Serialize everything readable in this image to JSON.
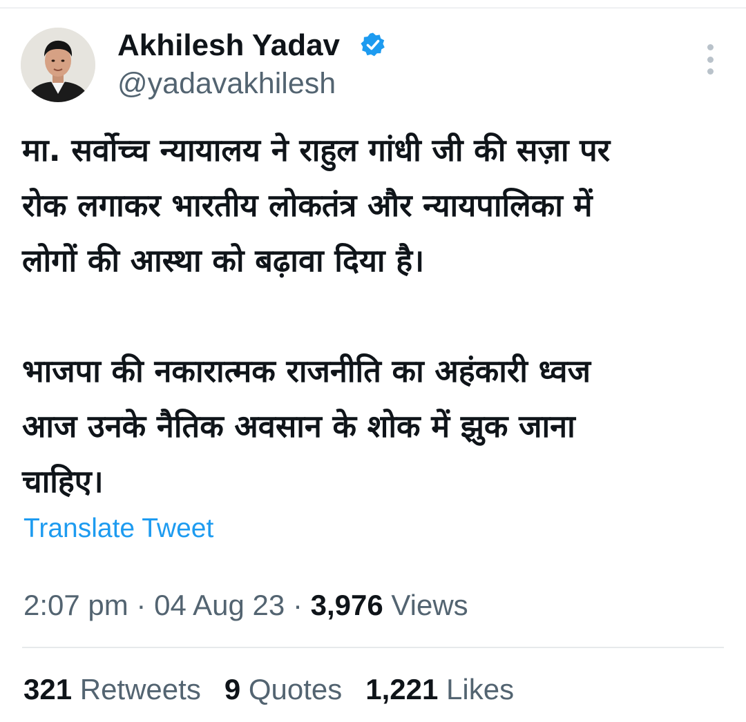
{
  "author": {
    "display_name": "Akhilesh Yadav",
    "handle": "@yadavakhilesh",
    "verified": true
  },
  "icons": {
    "avatar": "profile-photo",
    "verified": "verified-badge-icon",
    "more": "more-options-icon"
  },
  "tweet": {
    "text": "मा. सर्वोच्च न्यायालय ने राहुल गांधी जी की सज़ा पर\nरोक लगाकर भारतीय लोकतंत्र और न्यायपालिका में\nलोगों की आस्था को बढ़ावा दिया है।\n\nभाजपा की नकारात्मक राजनीति का अहंकारी ध्वज\nआज उनके नैतिक अवसान के शोक में झुक जाना\nचाहिए।",
    "translate_label": "Translate Tweet"
  },
  "meta": {
    "time": "2:07 pm",
    "separator": " · ",
    "date": "04 Aug 23",
    "views_count": "3,976",
    "views_label": " Views"
  },
  "stats": {
    "retweets_count": "321",
    "retweets_label": " Retweets",
    "quotes_count": "9",
    "quotes_label": " Quotes",
    "likes_count": "1,221",
    "likes_label": " Likes"
  },
  "colors": {
    "text": "#0f1419",
    "secondary": "#536471",
    "link": "#1d9bf0",
    "divider": "#e6e9eb"
  }
}
